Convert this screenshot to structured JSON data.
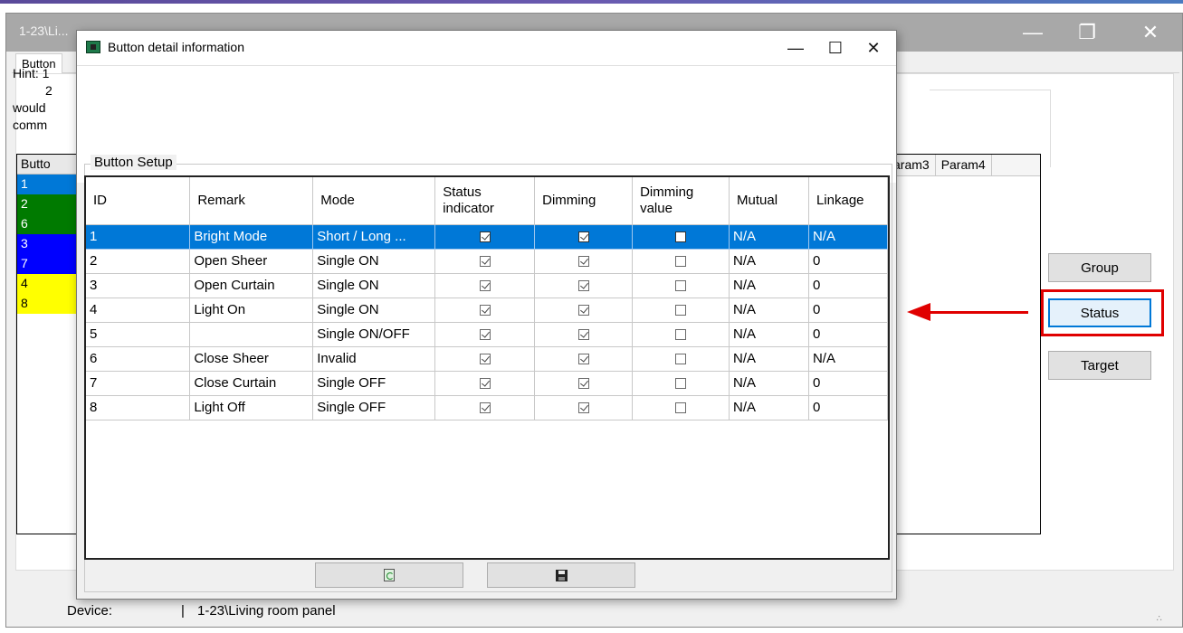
{
  "background_window": {
    "title": "1-23\\Li...",
    "tab_label": "Button",
    "hint_lines": [
      "Hint: 1",
      "2",
      "would",
      "comm"
    ],
    "list_header": "Butto",
    "list_items": [
      {
        "label": "1",
        "color": "#0078d7"
      },
      {
        "label": "2",
        "color": "#007a00"
      },
      {
        "label": "6",
        "color": "#007a00"
      },
      {
        "label": "3",
        "color": "#0000ff"
      },
      {
        "label": "7",
        "color": "#0000ff"
      },
      {
        "label": "4",
        "color": "#ffff00"
      },
      {
        "label": "8",
        "color": "#ffff00"
      }
    ],
    "grid_headers": [
      "aram3",
      "Param4"
    ],
    "side_buttons": {
      "group": "Group",
      "status": "Status",
      "target": "Target"
    },
    "status_bar": {
      "label": "Device:",
      "separator": "|",
      "value": "1-23\\Living room panel"
    }
  },
  "dialog": {
    "title": "Button detail information",
    "group_title": "Button Setup",
    "columns": [
      "ID",
      "Remark",
      "Mode",
      "Status indicator",
      "Dimming",
      "Dimming value",
      "Mutual",
      "Linkage"
    ],
    "rows": [
      {
        "id": "1",
        "remark": "Bright Mode",
        "mode": "Short / Long ...",
        "status_indicator": true,
        "dimming": true,
        "dimming_value": false,
        "mutual": "N/A",
        "linkage": "N/A",
        "selected": true
      },
      {
        "id": "2",
        "remark": "Open Sheer",
        "mode": "Single ON",
        "status_indicator": true,
        "dimming": true,
        "dimming_value": false,
        "mutual": "N/A",
        "linkage": "0",
        "selected": false
      },
      {
        "id": "3",
        "remark": "Open Curtain",
        "mode": "Single ON",
        "status_indicator": true,
        "dimming": true,
        "dimming_value": false,
        "mutual": "N/A",
        "linkage": "0",
        "selected": false
      },
      {
        "id": "4",
        "remark": "Light On",
        "mode": "Single ON",
        "status_indicator": true,
        "dimming": true,
        "dimming_value": false,
        "mutual": "N/A",
        "linkage": "0",
        "selected": false
      },
      {
        "id": "5",
        "remark": "",
        "mode": "Single ON/OFF",
        "status_indicator": true,
        "dimming": true,
        "dimming_value": false,
        "mutual": "N/A",
        "linkage": "0",
        "selected": false
      },
      {
        "id": "6",
        "remark": "Close Sheer",
        "mode": "Invalid",
        "status_indicator": true,
        "dimming": true,
        "dimming_value": false,
        "mutual": "N/A",
        "linkage": "N/A",
        "selected": false
      },
      {
        "id": "7",
        "remark": "Close Curtain",
        "mode": "Single OFF",
        "status_indicator": true,
        "dimming": true,
        "dimming_value": false,
        "mutual": "N/A",
        "linkage": "0",
        "selected": false
      },
      {
        "id": "8",
        "remark": "Light Off",
        "mode": "Single OFF",
        "status_indicator": true,
        "dimming": true,
        "dimming_value": false,
        "mutual": "N/A",
        "linkage": "0",
        "selected": false
      }
    ],
    "buttons": {
      "refresh_icon": "refresh-icon",
      "save_icon": "save-icon"
    }
  },
  "annotation": {
    "arrow_color": "#e00000",
    "highlight_color": "#e00000"
  }
}
